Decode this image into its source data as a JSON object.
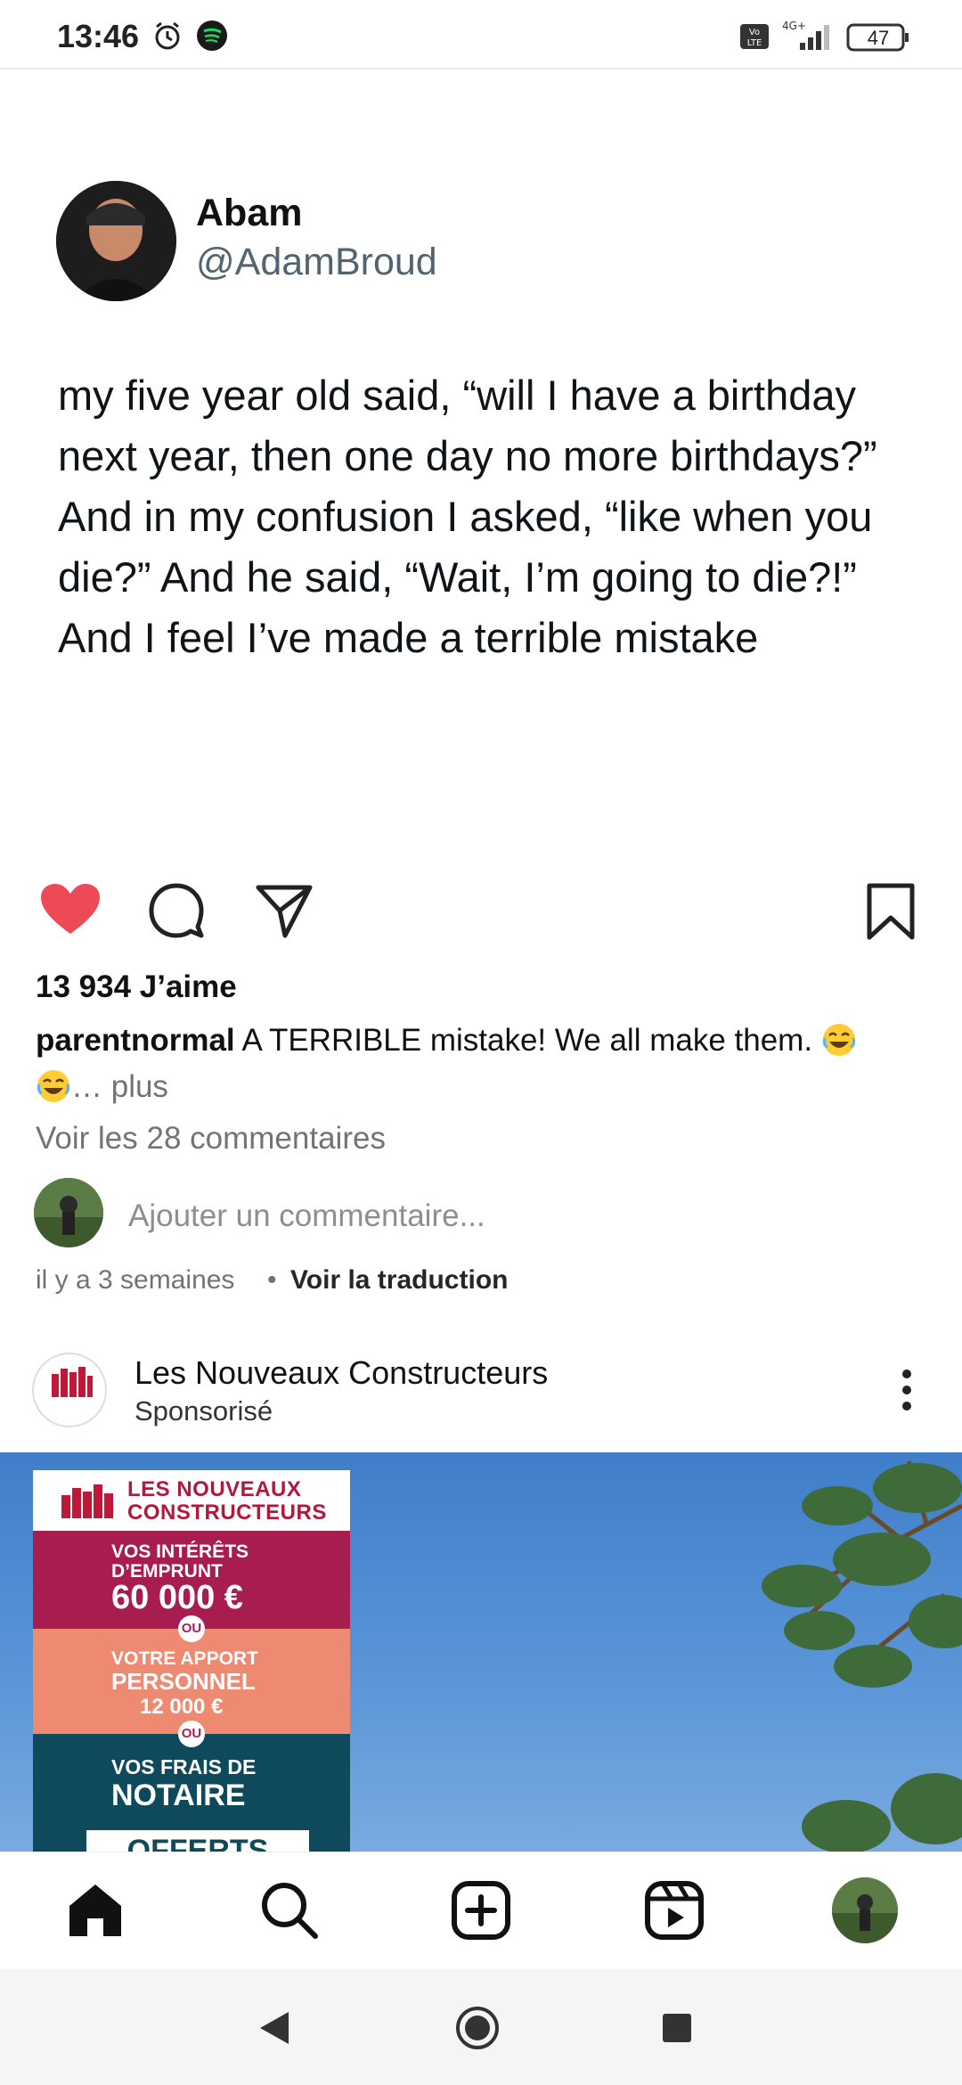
{
  "status_bar": {
    "time": "13:46",
    "network": "4G+",
    "volte": "VoLTE",
    "battery": "47",
    "icons": [
      "alarm-icon",
      "spotify-icon",
      "volte-icon",
      "signal-icon",
      "battery-icon"
    ]
  },
  "tweet": {
    "name": "Abam",
    "handle": "@AdamBroud",
    "text": "my five year old said, “will I have a birthday next year, then one day no more birthdays?” And in my confusion I asked, “like when you die?” And he said, “Wait, I’m going to die?!” And I feel I’ve made a terrible mistake"
  },
  "post": {
    "liked": true,
    "likes": "13 934 J’aime",
    "caption_user": "parentnormal",
    "caption_text": " A TERRIBLE mistake! We all make them. ",
    "caption_more": "… plus",
    "view_comments": "Voir les 28 commentaires",
    "add_comment_placeholder": "Ajouter un commentaire...",
    "timestamp": "il y a 3 semaines",
    "separator": "•",
    "translate": "Voir la traduction"
  },
  "sponsored": {
    "name": "Les Nouveaux Constructeurs",
    "label": "Sponsorisé",
    "logo_text": "LES NOUVEAUX CONSTRUCTEURS",
    "ad": {
      "title_line1": "LES NOUVEAUX",
      "title_line2": "CONSTRUCTEURS",
      "b1_line1": "VOS INTÉRÊTS",
      "b1_line2": "D’EMPRUNT",
      "b1_amount": "60 000 €",
      "or": "OU",
      "b2_line1": "VOTRE APPORT",
      "b2_line2": "PERSONNEL",
      "b2_amount": "12 000 €",
      "b3_line1": "VOS FRAIS DE",
      "b3_line2": "NOTAIRE",
      "b3_cta": "OFFERTS"
    }
  },
  "colors": {
    "heart": "#ed4956",
    "ad_crimson": "#a81d4f",
    "ad_salmon": "#ef8a72",
    "ad_teal": "#0f4a5c",
    "sky": "#4d8ad0"
  }
}
